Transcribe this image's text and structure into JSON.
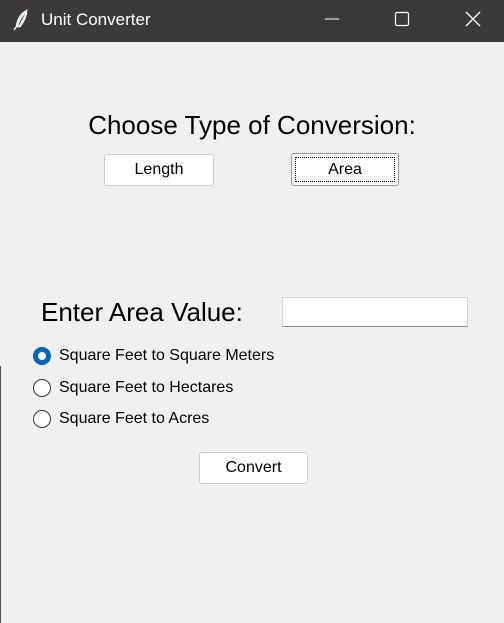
{
  "window": {
    "title": "Unit Converter",
    "app_icon": "feather-icon",
    "controls": {
      "minimize": "minimize-icon",
      "maximize": "maximize-icon",
      "close": "close-icon"
    }
  },
  "main": {
    "heading": "Choose Type of Conversion:",
    "type_buttons": [
      {
        "label": "Length",
        "focused": false
      },
      {
        "label": "Area",
        "focused": true
      }
    ],
    "value_label": "Enter Area Value:",
    "value_input": {
      "value": "",
      "placeholder": ""
    },
    "options": [
      {
        "label": "Square Feet to Square Meters",
        "checked": true
      },
      {
        "label": "Square Feet to Hectares",
        "checked": false
      },
      {
        "label": "Square Feet to Acres",
        "checked": false
      }
    ],
    "convert_label": "Convert"
  },
  "colors": {
    "titlebar": "#3b3a39",
    "background": "#f0f0f0",
    "accent": "#0067c0"
  }
}
